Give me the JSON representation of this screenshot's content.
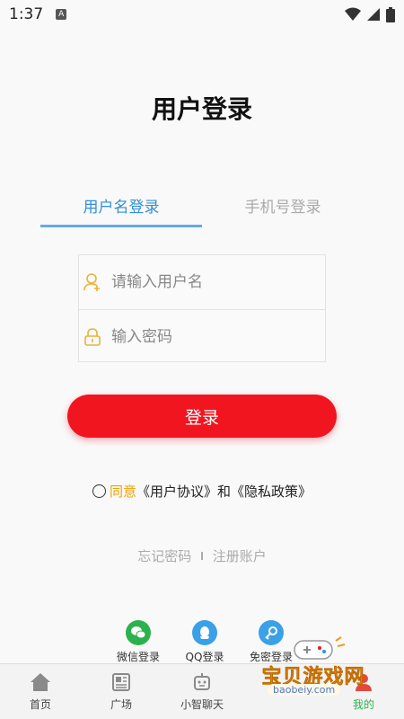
{
  "status_bar": {
    "time": "1:37",
    "app_icon": "A"
  },
  "page": {
    "title": "用户登录"
  },
  "tabs": [
    {
      "label": "用户名登录",
      "active": true
    },
    {
      "label": "手机号登录",
      "active": false
    }
  ],
  "form": {
    "username_placeholder": "请输入用户名",
    "password_placeholder": "输入密码"
  },
  "login_button": {
    "label": "登录"
  },
  "agreement": {
    "agree": "同意",
    "user_agreement": "《用户协议》",
    "and": "和",
    "privacy_policy": "《隐私政策》"
  },
  "links": {
    "forgot": "忘记密码",
    "separator": "I",
    "register": "注册账户"
  },
  "social_login": [
    {
      "label": "微信登录",
      "icon": "wechat-icon",
      "color": "#2bb24c"
    },
    {
      "label": "QQ登录",
      "icon": "qq-icon",
      "color": "#3aa0e8"
    },
    {
      "label": "免密登录",
      "icon": "key-icon",
      "color": "#3aa0e8"
    }
  ],
  "bottom_nav": [
    {
      "label": "首页",
      "icon": "home-icon"
    },
    {
      "label": "广场",
      "icon": "newspaper-icon"
    },
    {
      "label": "小智聊天",
      "icon": "robot-icon"
    },
    {
      "label": "",
      "icon": "share-icon"
    },
    {
      "label": "我的",
      "icon": "user-icon",
      "active": true
    }
  ],
  "watermark": {
    "text": "宝贝游戏网",
    "url": "baobeiy.com"
  },
  "colors": {
    "accent": "#2f8fd8",
    "primary_button": "#f0151f",
    "agree": "#f0a000",
    "nav_active": "#2bb24c"
  }
}
